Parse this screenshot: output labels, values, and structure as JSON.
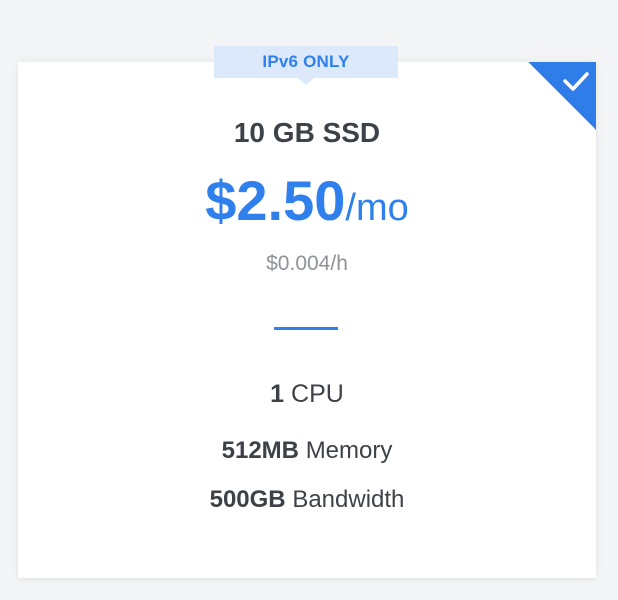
{
  "plan": {
    "badge": "IPv6 ONLY",
    "storage": "10 GB SSD",
    "price_amount": "$2.50",
    "price_period": "/mo",
    "hourly_price": "$0.004/h",
    "specs": {
      "cpu_value": "1",
      "cpu_label": "CPU",
      "memory_value": "512MB",
      "memory_label": "Memory",
      "bandwidth_value": "500GB",
      "bandwidth_label": "Bandwidth"
    },
    "selected": true,
    "selected_icon": "checkmark-icon"
  },
  "colors": {
    "accent": "#2f80ed",
    "badge_bg": "#dbe9fb",
    "text_primary": "#3d4148",
    "text_muted": "#8e9399",
    "page_bg": "#f4f5f7",
    "card_bg": "#ffffff"
  }
}
